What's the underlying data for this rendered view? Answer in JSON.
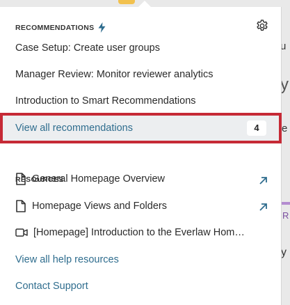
{
  "recommendations": {
    "header": "RECOMMENDATIONS",
    "items": [
      {
        "label": "Case Setup: Create user groups"
      },
      {
        "label": "Manager Review: Monitor reviewer analytics"
      },
      {
        "label": "Introduction to Smart Recommendations"
      }
    ],
    "view_all_label": "View all recommendations",
    "view_all_count": "4"
  },
  "resources": {
    "header": "RESOURCES",
    "items": [
      {
        "label": "General Homepage Overview",
        "icon": "document-icon",
        "external": true
      },
      {
        "label": "Homepage Views and Folders",
        "icon": "document-icon",
        "external": true
      },
      {
        "label": "[Homepage] Introduction to the Everlaw Hom…",
        "icon": "video-icon",
        "external": false
      }
    ],
    "view_all_help": "View all help resources",
    "contact_support": "Contact Support"
  },
  "background_peek": {
    "t1": "u",
    "t2": "y",
    "t3": "e",
    "t4": "R",
    "t5": "y"
  },
  "colors": {
    "accent_link": "#2f6d8e",
    "highlight_border": "#c62a36",
    "highlight_bg": "#eceef0",
    "external_arrow": "#2f6d8e"
  }
}
